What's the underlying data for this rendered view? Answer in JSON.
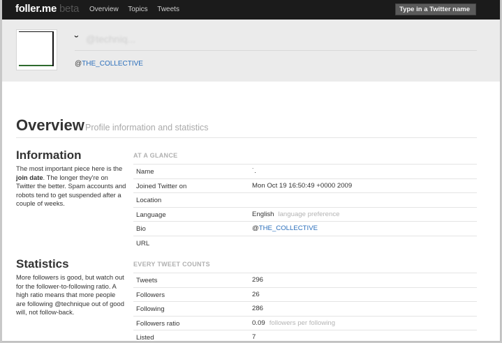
{
  "topbar": {
    "brand": "foller.me",
    "beta": "beta",
    "nav": [
      "Overview",
      "Topics",
      "Tweets"
    ],
    "search_placeholder": "Type in a Twitter name"
  },
  "profile": {
    "name_mark": "˘",
    "handle_obscured": "@techniq...",
    "bio_prefix": "@",
    "bio_link": "THE_COLLECTIVE"
  },
  "overview": {
    "title": "Overview",
    "subtitle": "Profile information and statistics"
  },
  "information": {
    "title": "Information",
    "desc_before": "The most important piece here is the ",
    "desc_bold": "join date",
    "desc_after": ". The longer they're on Twitter the better. Spam accounts and robots tend to get suspended after a couple of weeks.",
    "group_label": "AT A GLANCE",
    "rows": [
      {
        "key": "Name",
        "value": "˙."
      },
      {
        "key": "Joined Twitter on",
        "value": "Mon Oct 19 16:50:49 +0000 2009"
      },
      {
        "key": "Location",
        "value": ""
      },
      {
        "key": "Language",
        "value": "English",
        "hint": "language preference"
      },
      {
        "key": "Bio",
        "value_prefix": "@",
        "value_link": "THE_COLLECTIVE"
      },
      {
        "key": "URL",
        "value": ""
      }
    ]
  },
  "statistics": {
    "title": "Statistics",
    "desc": "More followers is good, but watch out for the follower-to-following ratio. A high ratio means that more people are following @technique out of good will, not follow-back.",
    "group_label": "EVERY TWEET COUNTS",
    "rows": [
      {
        "key": "Tweets",
        "value": "296"
      },
      {
        "key": "Followers",
        "value": "26"
      },
      {
        "key": "Following",
        "value": "286"
      },
      {
        "key": "Followers ratio",
        "value": "0.09",
        "hint": "followers per following"
      },
      {
        "key": "Listed",
        "value": "7"
      }
    ]
  }
}
